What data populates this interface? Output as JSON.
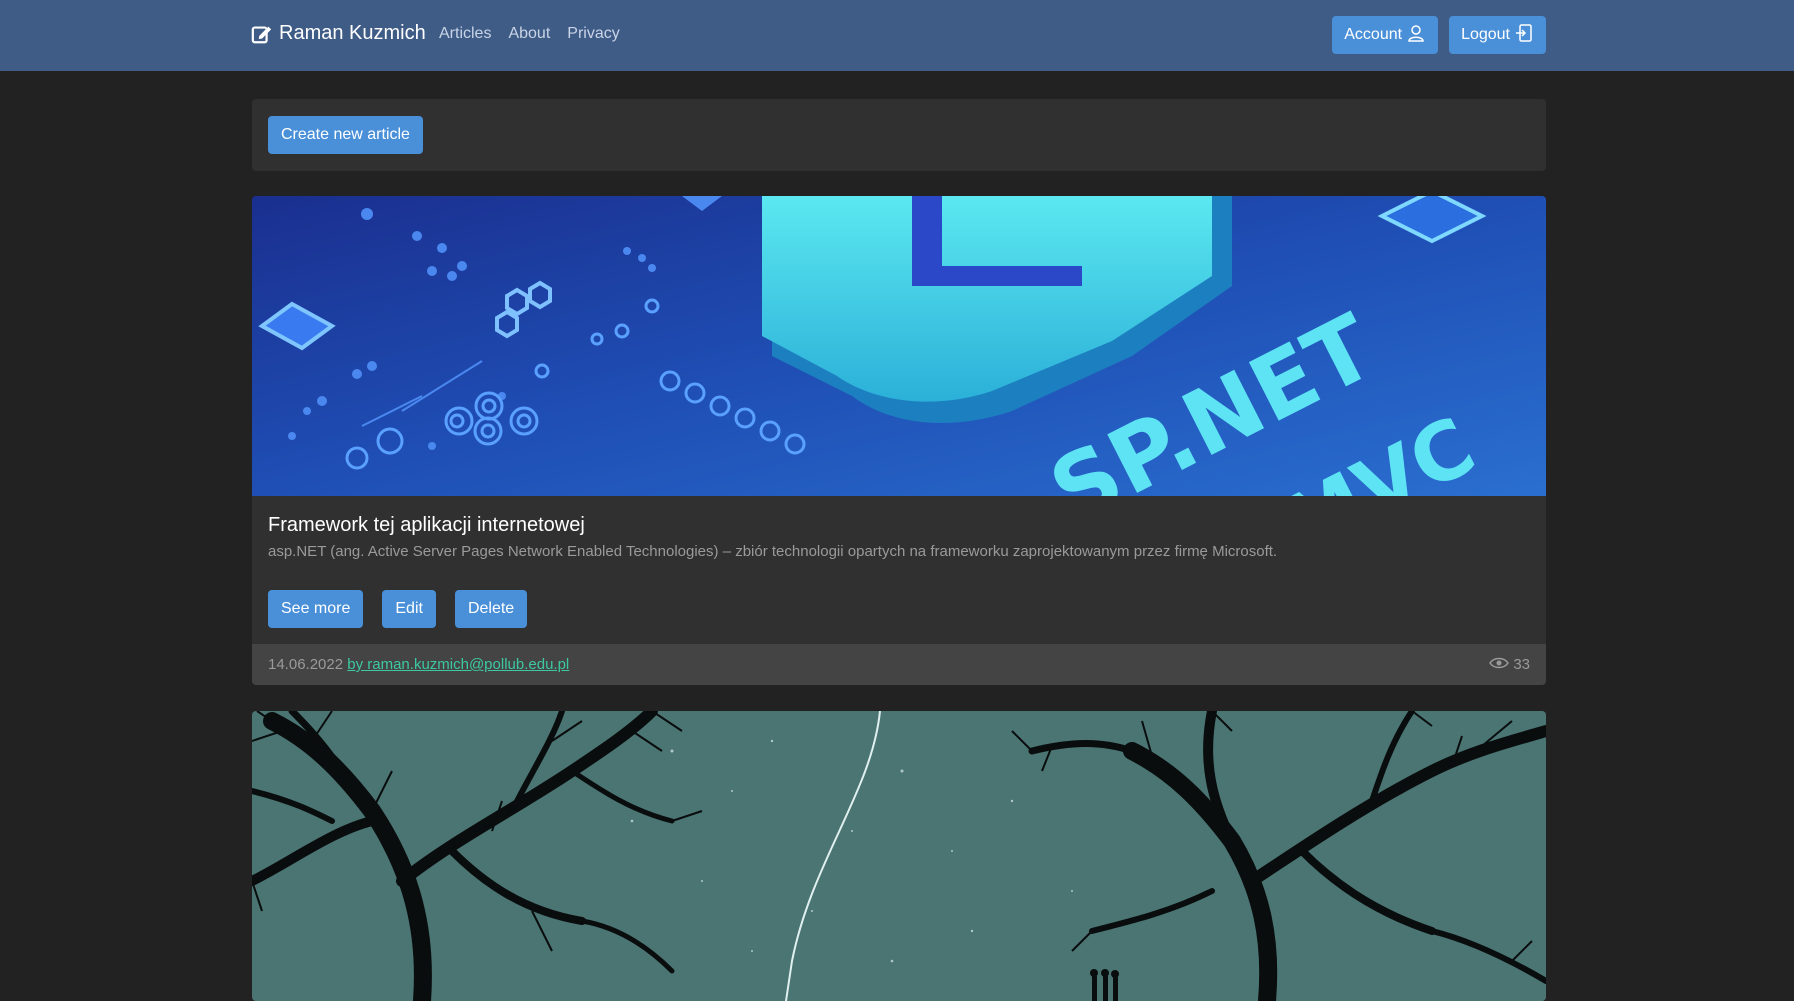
{
  "navbar": {
    "brand": "Raman Kuzmich",
    "links": [
      "Articles",
      "About",
      "Privacy"
    ],
    "account_label": "Account",
    "logout_label": "Logout"
  },
  "toolbar": {
    "create_label": "Create new article"
  },
  "articles": [
    {
      "image_name": "asp-net-mvc-banner",
      "title": "Framework tej aplikacji internetowej",
      "description": "asp.NET (ang. Active Server Pages Network Enabled Technologies) – zbiór technologii opartych na frameworku zaprojektowanym przez firmę Microsoft.",
      "see_more_label": "See more",
      "edit_label": "Edit",
      "delete_label": "Delete",
      "date": "14.06.2022",
      "author": "by raman.kuzmich@pollub.edu.pl",
      "views": "33"
    },
    {
      "image_name": "night-sky-trees-banner"
    }
  ],
  "colors": {
    "navbar": "#3f5c87",
    "page_bg": "#222222",
    "card_bg": "#303030",
    "footer_bg": "#444444",
    "button": "#4a90d9",
    "link": "#3cc9a0"
  }
}
